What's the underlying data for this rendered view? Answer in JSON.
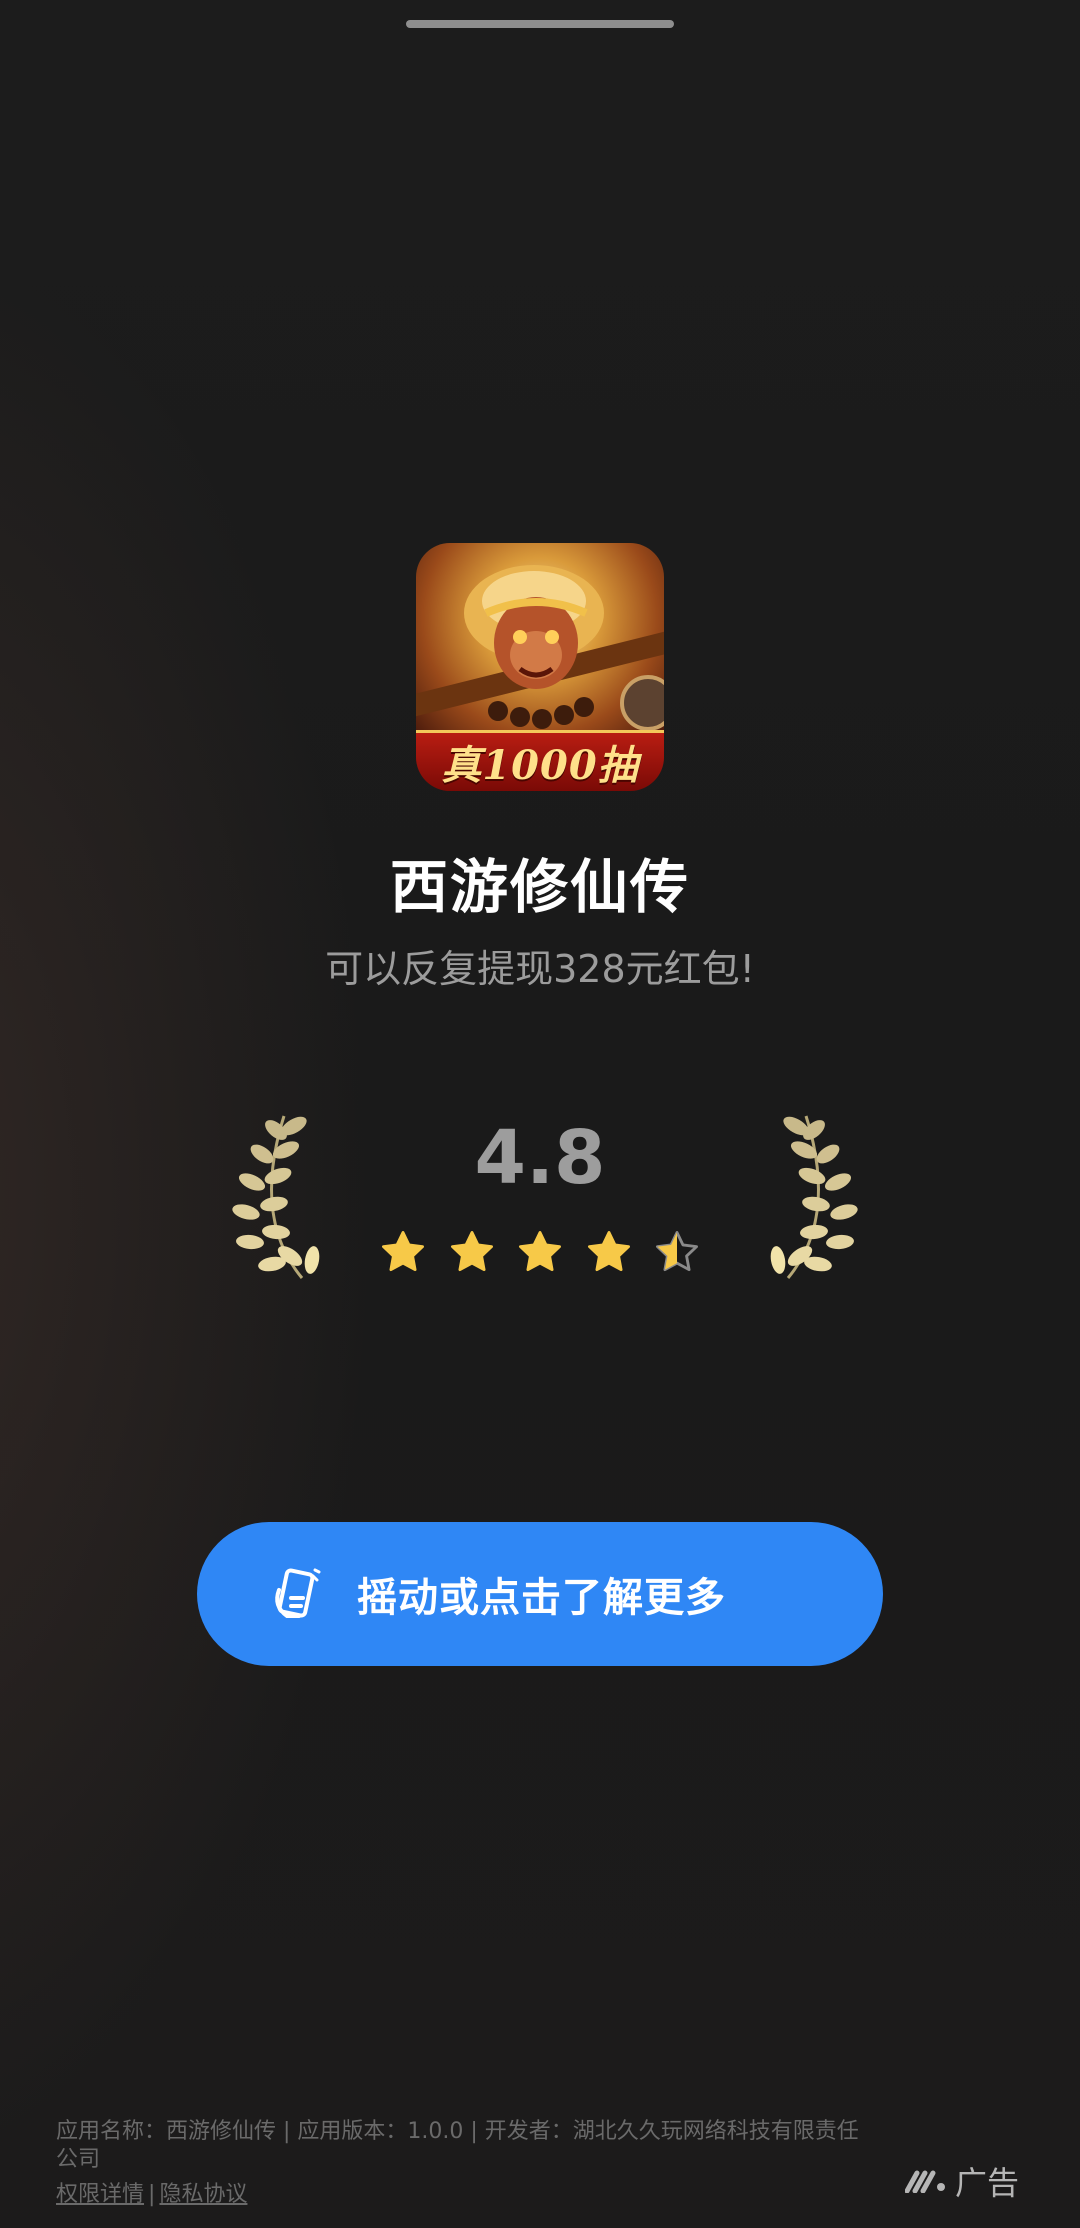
{
  "app": {
    "name": "西游修仙传",
    "tagline": "可以反复提现328元红包!",
    "icon_banner": "真1000抽"
  },
  "rating": {
    "value": "4.8",
    "stars_filled": 4.5,
    "stars_total": 5,
    "star_color": "#f7c948"
  },
  "cta": {
    "label": "摇动或点击了解更多",
    "color": "#2f87f5",
    "icon": "shake-phone-icon"
  },
  "footer": {
    "info": "应用名称：西游修仙传 | 应用版本：1.0.0 | 开发者：湖北久久玩网络科技有限责任公司",
    "permissions_link": "权限详情",
    "separator": "|",
    "privacy_link": "隐私协议",
    "ad_label": "广告",
    "ad_icon": "ad-network-logo-icon"
  }
}
